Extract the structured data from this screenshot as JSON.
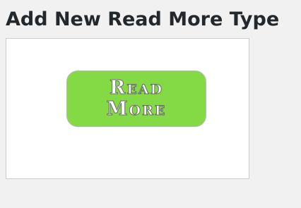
{
  "page": {
    "title": "Add New Read More Type"
  },
  "preview": {
    "button": {
      "label": "Read More",
      "background_color": "#83da45",
      "text_color": "#ffffff"
    }
  }
}
